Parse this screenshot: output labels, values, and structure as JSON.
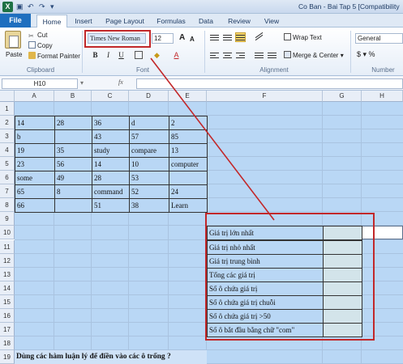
{
  "titlebar": {
    "logo": "X",
    "title": "Co Ban - Bai Tap 5 [Compatibility"
  },
  "tabs": [
    "Home",
    "Insert",
    "Page Layout",
    "Formulas",
    "Data",
    "Review",
    "View"
  ],
  "file_tab": "File",
  "ribbon": {
    "clipboard": {
      "paste": "Paste",
      "cut": "Cut",
      "copy": "Copy",
      "format_painter": "Format Painter",
      "group_label": "Clipboard"
    },
    "font": {
      "font_name": "Times New Roman",
      "font_size": "12",
      "bold": "B",
      "italic": "I",
      "underline": "U",
      "group_label": "Font",
      "grow": "A",
      "shrink": "A"
    },
    "alignment": {
      "wrap_text": "Wrap Text",
      "merge_center": "Merge & Center",
      "group_label": "Alignment"
    },
    "number": {
      "format": "General",
      "group_label": "Number"
    }
  },
  "formula_bar": {
    "name_box": "H10",
    "fx": "fx",
    "formula": ""
  },
  "sheet": {
    "columns": [
      "A",
      "B",
      "C",
      "D",
      "E",
      "F",
      "G",
      "H"
    ],
    "rows": [
      "1",
      "2",
      "3",
      "4",
      "5",
      "6",
      "7",
      "8",
      "9",
      "10",
      "11",
      "12",
      "13",
      "14",
      "15",
      "16",
      "17",
      "18",
      "19"
    ],
    "data_table": [
      [
        "14",
        "28",
        "36",
        "d",
        "2"
      ],
      [
        "b",
        "",
        "43",
        "57",
        "85"
      ],
      [
        "19",
        "35",
        "study",
        "compare",
        "13"
      ],
      [
        "23",
        "56",
        "14",
        "10",
        "computer"
      ],
      [
        "some",
        "49",
        "28",
        "53",
        ""
      ],
      [
        "65",
        "8",
        "command",
        "52",
        "24"
      ],
      [
        "66",
        "",
        "51",
        "38",
        "Learn"
      ]
    ],
    "criteria_labels": [
      "Giá trị lớn nhất",
      "Giá trị nhỏ nhất",
      "Giá trị trung bình",
      "Tổng các giá trị",
      "Số ô chứa giá trị",
      "Số ô chứa giá trị chuỗi",
      "Số ô chứa giá trị >50",
      "Số ô bắt đầu bằng chữ \"com\""
    ],
    "footer": "Dùng các hàm luận lý để điền vào các ô trống ?"
  },
  "colors": {
    "grid_fill": "#b9d7f5",
    "answer_fill": "#d3e4ea",
    "highlight": "#c2282a",
    "file_tab": "#1f6fbf"
  }
}
